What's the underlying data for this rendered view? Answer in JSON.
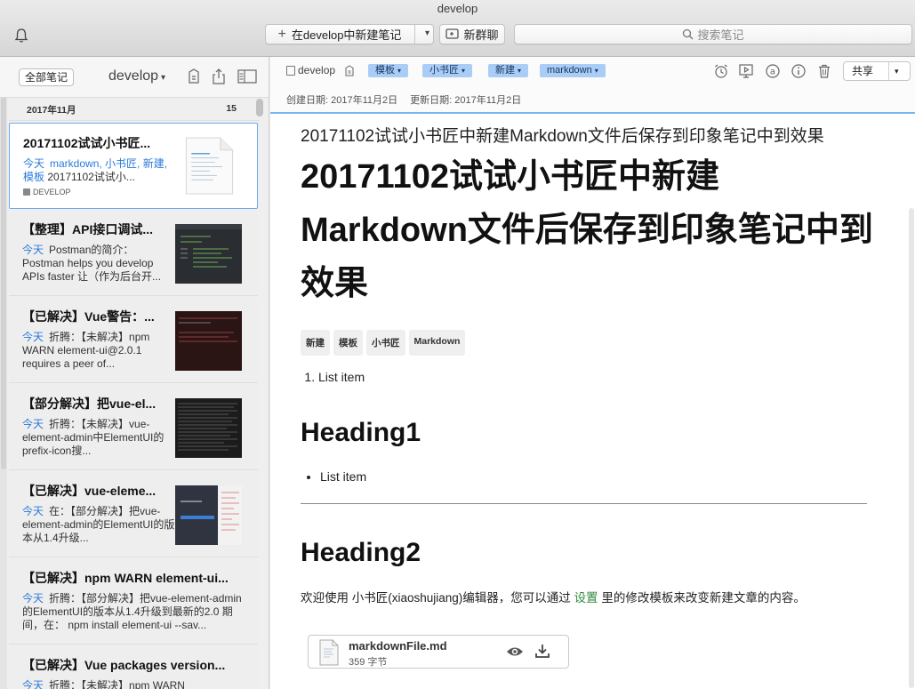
{
  "window": {
    "title": "develop"
  },
  "toolbar": {
    "new_note_label": "在develop中新建笔记",
    "new_chat_label": "新群聊",
    "search_placeholder": "搜索笔记"
  },
  "sidebar": {
    "all_notes_label": "全部笔记",
    "notebook_title": "develop",
    "month_label": "2017年11月",
    "note_count": "15",
    "notes": [
      {
        "title": "20171102试试小书匠...",
        "date": "今天",
        "tags": "markdown, 小书匠, 新建, 模板",
        "snippet": "20171102试试小...",
        "notebook": "DEVELOP"
      },
      {
        "title": "【整理】API接口调试...",
        "date": "今天",
        "snippet": "Postman的简介：Postman helps you develop APIs faster 让（作为后台开..."
      },
      {
        "title": "【已解决】Vue警告：...",
        "date": "今天",
        "snippet": "折腾：【未解决】npm WARN element-ui@2.0.1 requires a peer of..."
      },
      {
        "title": "【部分解决】把vue-el...",
        "date": "今天",
        "snippet": "折腾：【未解决】vue-element-admin中ElementUI的prefix-icon搜..."
      },
      {
        "title": "【已解决】vue-eleme...",
        "date": "今天",
        "snippet": "在：【部分解决】把vue-element-admin的ElementUI的版本从1.4升级..."
      },
      {
        "title": "【已解决】npm WARN element-ui...",
        "date": "今天",
        "snippet": "折腾：【部分解决】把vue-element-admin的ElementUI的版本从1.4升级到最新的2.0 期间，在： npm install element-ui --sav..."
      },
      {
        "title": "【已解决】Vue packages version...",
        "date": "今天",
        "snippet": "折腾：【未解决】npm WARN"
      }
    ]
  },
  "note": {
    "notebook": "develop",
    "tags": [
      "模板",
      "小书匠",
      "新建",
      "markdown"
    ],
    "created": "创建日期: 2017年11月2日",
    "updated": "更新日期: 2017年11月2日",
    "share_label": "共享",
    "title": "20171102试试小书匠中新建Markdown文件后保存到印象笔记中到效果",
    "h1": "20171102试试小书匠中新建Markdown文件后保存到印象笔记中到效果",
    "body_tags": [
      "新建",
      "模板",
      "小书匠",
      "Markdown"
    ],
    "ol_item": "List item",
    "heading1": "Heading1",
    "ul_item": "List item",
    "heading2": "Heading2",
    "para_before": "欢迎使用 小书匠(xiaoshujiang)编辑器，您可以通过",
    "para_link": "设置",
    "para_after": "里的修改模板来改变新建文章的内容。",
    "attachment": {
      "name": "markdownFile.md",
      "size": "359 字节"
    }
  }
}
